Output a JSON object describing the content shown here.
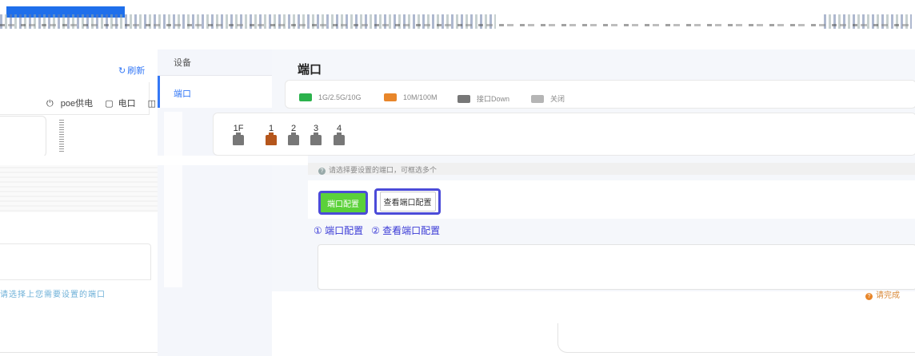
{
  "sidebar_left": {
    "refresh_label": "刷新",
    "legend": [
      "poe供电",
      "电口",
      "光口"
    ],
    "hint": "请选择上您需要设置的端口"
  },
  "nav": {
    "items": [
      {
        "label": "设备",
        "active": false
      },
      {
        "label": "端口",
        "active": true
      }
    ]
  },
  "main": {
    "title": "端口",
    "legend": [
      {
        "label": "1G/2.5G/10G",
        "color": "#2bb24c"
      },
      {
        "label": "10M/100M",
        "color": "#e8862a"
      },
      {
        "label": "接口Down",
        "color": "#777777"
      },
      {
        "label": "关闭",
        "color": "#b5b5b5"
      }
    ],
    "ports": [
      {
        "label": "1F",
        "color": "#777777"
      },
      {
        "label": "1",
        "color": "#b5561c"
      },
      {
        "label": "2",
        "color": "#777777"
      },
      {
        "label": "3",
        "color": "#777777"
      },
      {
        "label": "4",
        "color": "#777777"
      }
    ],
    "select_hint": "请选择要设置的端口，可框选多个",
    "buttons": {
      "port_config": "端口配置",
      "view_config": "查看端口配置"
    },
    "annotations": [
      "① 端口配置",
      "② 查看端口配置"
    ],
    "warn_hint": "请完成"
  },
  "colors": {
    "accent": "#3478f6",
    "highlight_border": "#4b4bd8",
    "primary_button": "#5bd13a"
  }
}
